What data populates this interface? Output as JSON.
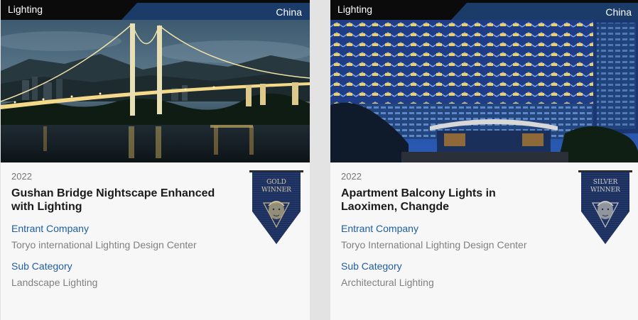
{
  "cards": [
    {
      "category": "Lighting",
      "country": "China",
      "photo_subject": "suspension-bridge-night-photo",
      "year": "2022",
      "title": "Gushan Bridge Nightscape Enhanced with Lighting",
      "entrant_label": "Entrant Company",
      "entrant": "Toryo international Lighting Design Center",
      "subcat_label": "Sub Category",
      "subcategory": "Landscape Lighting",
      "badge_line1": "GOLD",
      "badge_line2": "WINNER",
      "badge_color": "#1d2f5c"
    },
    {
      "category": "Lighting",
      "country": "China",
      "photo_subject": "apartment-balcony-lights-photo",
      "year": "2022",
      "title": "Apartment Balcony Lights in Laoximen, Changde",
      "entrant_label": "Entrant Company",
      "entrant": "Toryo International Lighting Design Center",
      "subcat_label": "Sub Category",
      "subcategory": "Architectural Lighting",
      "badge_line1": "SILVER",
      "badge_line2": "WINNER",
      "badge_color": "#1d2f5c"
    }
  ],
  "colors": {
    "top_bar": "#0b0b0b",
    "country_band": "#1b3b69",
    "link_blue": "#1d5ea5",
    "value_gray": "#808080",
    "card_bg": "#f7f7f7"
  }
}
